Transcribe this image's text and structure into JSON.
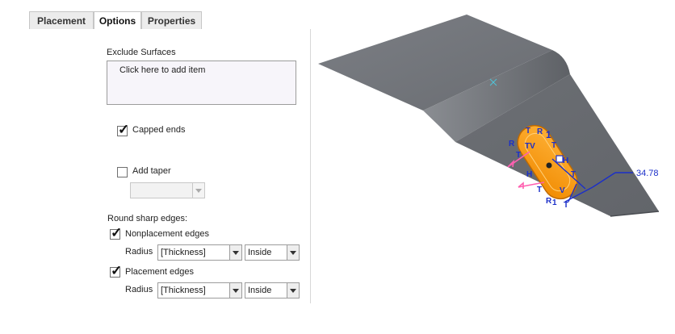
{
  "tabs": [
    {
      "label": "Placement"
    },
    {
      "label": "Options"
    },
    {
      "label": "Properties"
    }
  ],
  "exclude_surfaces": {
    "label": "Exclude Surfaces",
    "placeholder": "Click here to add item"
  },
  "capped_ends": {
    "label": "Capped ends",
    "checked": true
  },
  "add_taper": {
    "label": "Add taper",
    "checked": false,
    "value": ""
  },
  "round_sharp_edges": {
    "label": "Round sharp edges:",
    "nonplacement": {
      "label": "Nonplacement edges",
      "checked": true,
      "radius_label": "Radius",
      "radius_value": "[Thickness]",
      "side_value": "Inside"
    },
    "placement": {
      "label": "Placement edges",
      "checked": true,
      "radius_label": "Radius",
      "radius_value": "[Thickness]",
      "side_value": "Inside"
    }
  },
  "viewport": {
    "dimension_value": "34.78",
    "handle_labels": {
      "t": "T",
      "r": "R",
      "one": "1",
      "v": "V",
      "h": "H",
      "tv": "TV"
    },
    "colors": {
      "part": "#6d7076",
      "feature": "#ff9b1a",
      "dimension": "#1b2fc9",
      "datum": "#4fc3d8"
    }
  }
}
